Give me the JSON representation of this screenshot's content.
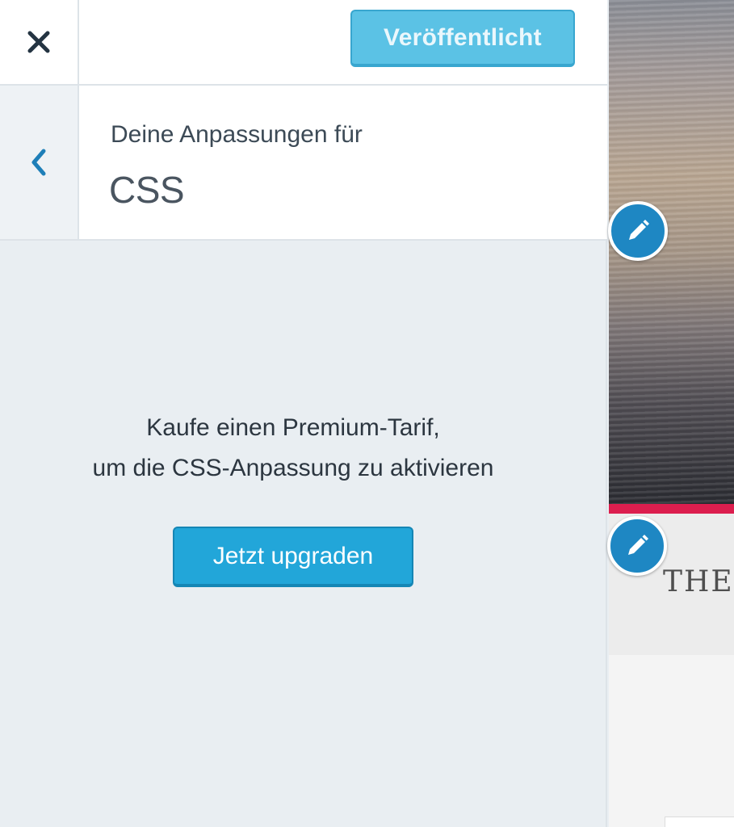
{
  "header": {
    "close_icon": "close-icon",
    "publish_label": "Veröffentlicht"
  },
  "section": {
    "back_icon": "chevron-left-icon",
    "subtitle": "Deine Anpassungen für",
    "title": "CSS"
  },
  "notice": {
    "line1": "Kaufe einen Premium-Tarif,",
    "line2": "um die CSS-Anpassung zu aktivieren",
    "upgrade_label": "Jetzt upgraden"
  },
  "preview": {
    "site_text": "THE",
    "edit_icon": "pencil-icon"
  },
  "colors": {
    "publish_bg": "#5bc2e5",
    "upgrade_bg": "#22a6d9",
    "edit_shortcut": "#1e87c3",
    "accent_bar": "#dc1e4e",
    "sidebar_bg": "#e9eef2"
  }
}
